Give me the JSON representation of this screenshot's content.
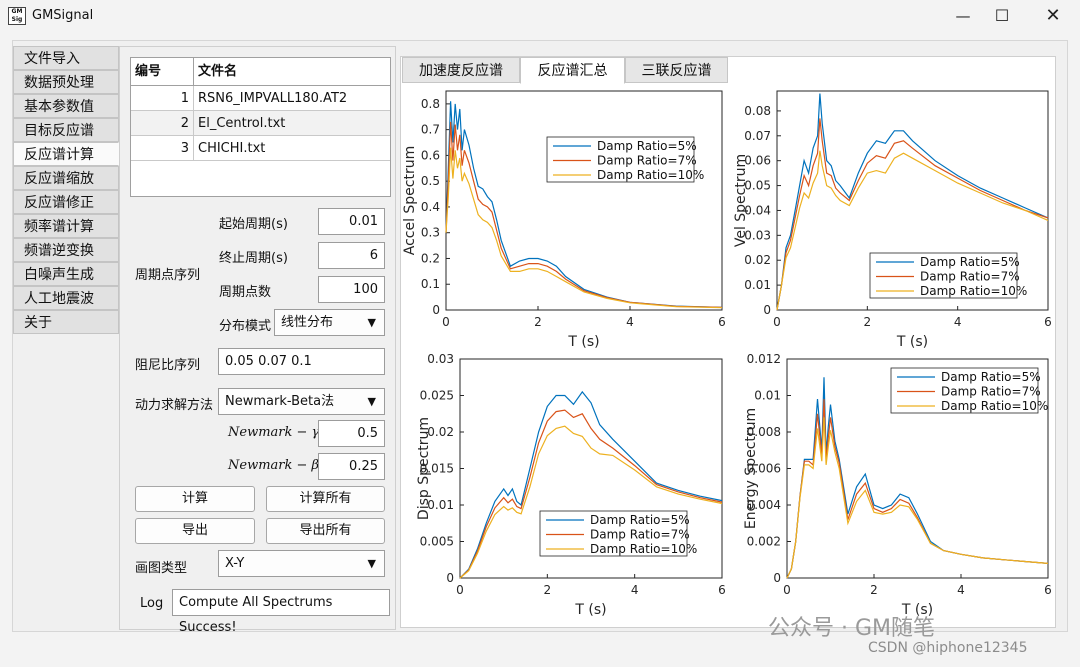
{
  "window": {
    "title": "GMSignal",
    "icon_text": "GM Signal",
    "minimize_icon": "minimize-icon",
    "maximize_icon": "maximize-icon",
    "close_icon": "close-icon"
  },
  "sidebar": {
    "items": [
      {
        "label": "文件导入"
      },
      {
        "label": "数据预处理"
      },
      {
        "label": "基本参数值"
      },
      {
        "label": "目标反应谱"
      },
      {
        "label": "反应谱计算"
      },
      {
        "label": "反应谱缩放"
      },
      {
        "label": "反应谱修正"
      },
      {
        "label": "频率谱计算"
      },
      {
        "label": "频谱逆变换"
      },
      {
        "label": "白噪声生成"
      },
      {
        "label": "人工地震波"
      },
      {
        "label": "关于"
      }
    ],
    "active_index": 4
  },
  "file_table": {
    "headers": [
      "编号",
      "文件名"
    ],
    "rows": [
      {
        "num": "1",
        "name": "RSN6_IMPVALL180.AT2"
      },
      {
        "num": "2",
        "name": "El_Centrol.txt"
      },
      {
        "num": "3",
        "name": "CHICHI.txt"
      }
    ]
  },
  "period": {
    "group_label": "周期点序列",
    "start_label": "起始周期(s)",
    "start_value": "0.01",
    "end_label": "终止周期(s)",
    "end_value": "6",
    "count_label": "周期点数",
    "count_value": "100",
    "dist_label": "分布模式",
    "dist_value": "线性分布"
  },
  "damping": {
    "label": "阻尼比序列",
    "value": "0.05  0.07   0.1"
  },
  "solver": {
    "label": "动力求解方法",
    "value": "Newmark-Beta法"
  },
  "newmark": {
    "gamma_label": "Newmark − γ",
    "gamma_value": "0.5",
    "beta_label": "Newmark − β",
    "beta_value": "0.25"
  },
  "buttons": {
    "compute": "计算",
    "compute_all": "计算所有",
    "export": "导出",
    "export_all": "导出所有"
  },
  "plot_type": {
    "label": "画图类型",
    "value": "X-Y"
  },
  "log": {
    "label": "Log",
    "value": "Compute All Spectrums Success!"
  },
  "tabs": [
    {
      "label": "加速度反应谱"
    },
    {
      "label": "反应谱汇总"
    },
    {
      "label": "三联反应谱"
    }
  ],
  "active_tab": 1,
  "colors": {
    "damp5": "#0072BD",
    "damp7": "#D95319",
    "damp10": "#EDB120"
  },
  "watermark": {
    "text": "公众号 · GM随笔",
    "csdn": "CSDN @hiphone12345"
  },
  "chart_data": [
    {
      "type": "line",
      "xlabel": "T (s)",
      "ylabel": "Accel Spectrum",
      "xlim": [
        0,
        6
      ],
      "ylim": [
        0,
        0.85
      ],
      "xticks": [
        0,
        2,
        4,
        6
      ],
      "yticks": [
        0,
        0.1,
        0.2,
        0.3,
        0.4,
        0.5,
        0.6,
        0.7,
        0.8
      ],
      "legend_position": "top-center",
      "x": [
        0,
        0.05,
        0.1,
        0.15,
        0.2,
        0.25,
        0.3,
        0.35,
        0.4,
        0.5,
        0.6,
        0.7,
        0.8,
        0.9,
        1.0,
        1.1,
        1.2,
        1.4,
        1.6,
        1.8,
        2.0,
        2.2,
        2.4,
        2.6,
        3.0,
        3.5,
        4.0,
        5.0,
        6.0
      ],
      "series": [
        {
          "name": "Damp Ratio=5%",
          "values": [
            0.3,
            0.55,
            0.81,
            0.65,
            0.8,
            0.7,
            0.78,
            0.62,
            0.7,
            0.64,
            0.55,
            0.48,
            0.47,
            0.44,
            0.42,
            0.35,
            0.27,
            0.17,
            0.19,
            0.2,
            0.2,
            0.19,
            0.17,
            0.13,
            0.08,
            0.05,
            0.03,
            0.015,
            0.01
          ]
        },
        {
          "name": "Damp Ratio=7%",
          "values": [
            0.3,
            0.5,
            0.73,
            0.58,
            0.72,
            0.62,
            0.68,
            0.56,
            0.62,
            0.57,
            0.5,
            0.43,
            0.41,
            0.4,
            0.38,
            0.31,
            0.24,
            0.16,
            0.17,
            0.18,
            0.18,
            0.17,
            0.15,
            0.12,
            0.075,
            0.048,
            0.03,
            0.014,
            0.01
          ]
        },
        {
          "name": "Damp Ratio=10%",
          "values": [
            0.3,
            0.44,
            0.63,
            0.51,
            0.62,
            0.55,
            0.59,
            0.5,
            0.53,
            0.49,
            0.43,
            0.37,
            0.35,
            0.34,
            0.32,
            0.27,
            0.21,
            0.15,
            0.15,
            0.16,
            0.16,
            0.15,
            0.13,
            0.11,
            0.07,
            0.045,
            0.028,
            0.013,
            0.009
          ]
        }
      ]
    },
    {
      "type": "line",
      "xlabel": "T (s)",
      "ylabel": "Vel Spectrum",
      "xlim": [
        0,
        6
      ],
      "ylim": [
        0,
        0.088
      ],
      "xticks": [
        0,
        2,
        4,
        6
      ],
      "yticks": [
        0,
        0.01,
        0.02,
        0.03,
        0.04,
        0.05,
        0.06,
        0.07,
        0.08
      ],
      "legend_position": "bottom-right",
      "x": [
        0,
        0.1,
        0.2,
        0.3,
        0.4,
        0.5,
        0.6,
        0.7,
        0.8,
        0.9,
        0.95,
        1.0,
        1.1,
        1.2,
        1.3,
        1.4,
        1.6,
        1.8,
        2.0,
        2.2,
        2.4,
        2.6,
        2.8,
        3.0,
        3.5,
        4.0,
        4.5,
        5.0,
        5.5,
        6.0
      ],
      "series": [
        {
          "name": "Damp Ratio=5%",
          "values": [
            0,
            0.01,
            0.025,
            0.03,
            0.04,
            0.05,
            0.06,
            0.055,
            0.065,
            0.07,
            0.087,
            0.075,
            0.06,
            0.058,
            0.052,
            0.05,
            0.045,
            0.055,
            0.063,
            0.068,
            0.067,
            0.072,
            0.072,
            0.068,
            0.06,
            0.054,
            0.049,
            0.045,
            0.041,
            0.037
          ]
        },
        {
          "name": "Damp Ratio=7%",
          "values": [
            0,
            0.01,
            0.023,
            0.028,
            0.037,
            0.046,
            0.054,
            0.05,
            0.058,
            0.063,
            0.077,
            0.068,
            0.055,
            0.054,
            0.049,
            0.047,
            0.044,
            0.052,
            0.059,
            0.062,
            0.061,
            0.067,
            0.068,
            0.065,
            0.058,
            0.053,
            0.048,
            0.044,
            0.04,
            0.037
          ]
        },
        {
          "name": "Damp Ratio=10%",
          "values": [
            0,
            0.01,
            0.021,
            0.025,
            0.033,
            0.041,
            0.047,
            0.045,
            0.051,
            0.055,
            0.064,
            0.058,
            0.05,
            0.049,
            0.046,
            0.044,
            0.042,
            0.049,
            0.055,
            0.056,
            0.055,
            0.061,
            0.063,
            0.061,
            0.056,
            0.051,
            0.047,
            0.043,
            0.04,
            0.036
          ]
        }
      ]
    },
    {
      "type": "line",
      "xlabel": "T (s)",
      "ylabel": "Disp Spectrum",
      "xlim": [
        0,
        6
      ],
      "ylim": [
        0,
        0.03
      ],
      "xticks": [
        0,
        2,
        4,
        6
      ],
      "yticks": [
        0,
        0.005,
        0.01,
        0.015,
        0.02,
        0.025,
        0.03
      ],
      "legend_position": "bottom-center",
      "x": [
        0,
        0.2,
        0.4,
        0.6,
        0.8,
        1.0,
        1.1,
        1.2,
        1.3,
        1.4,
        1.6,
        1.8,
        2.0,
        2.2,
        2.4,
        2.6,
        2.8,
        3.0,
        3.2,
        3.5,
        4.0,
        4.5,
        5.0,
        5.5,
        6.0
      ],
      "series": [
        {
          "name": "Damp Ratio=5%",
          "values": [
            0,
            0.0012,
            0.004,
            0.0075,
            0.0105,
            0.0122,
            0.0113,
            0.0122,
            0.0105,
            0.01,
            0.015,
            0.02,
            0.0235,
            0.025,
            0.025,
            0.0238,
            0.0255,
            0.024,
            0.021,
            0.019,
            0.016,
            0.013,
            0.012,
            0.0112,
            0.0106
          ]
        },
        {
          "name": "Damp Ratio=7%",
          "values": [
            0,
            0.0011,
            0.0037,
            0.007,
            0.0096,
            0.011,
            0.0103,
            0.0108,
            0.0098,
            0.0095,
            0.0138,
            0.0185,
            0.0215,
            0.0228,
            0.023,
            0.022,
            0.0225,
            0.0205,
            0.019,
            0.0178,
            0.0154,
            0.0128,
            0.0118,
            0.011,
            0.0104
          ]
        },
        {
          "name": "Damp Ratio=10%",
          "values": [
            0,
            0.001,
            0.0034,
            0.0064,
            0.0087,
            0.0098,
            0.0093,
            0.0096,
            0.009,
            0.0088,
            0.0125,
            0.017,
            0.0195,
            0.0205,
            0.0208,
            0.0198,
            0.0194,
            0.0178,
            0.017,
            0.0168,
            0.0148,
            0.0125,
            0.0115,
            0.0108,
            0.0102
          ]
        }
      ]
    },
    {
      "type": "line",
      "xlabel": "T (s)",
      "ylabel": "Energy Spectrum",
      "xlim": [
        0,
        6
      ],
      "ylim": [
        0,
        0.012
      ],
      "xticks": [
        0,
        2,
        4,
        6
      ],
      "yticks": [
        0,
        0.002,
        0.004,
        0.006,
        0.008,
        0.01,
        0.012
      ],
      "legend_position": "top-right",
      "x": [
        0,
        0.1,
        0.2,
        0.3,
        0.4,
        0.5,
        0.6,
        0.7,
        0.8,
        0.85,
        0.9,
        0.95,
        1.0,
        1.1,
        1.2,
        1.4,
        1.6,
        1.8,
        2.0,
        2.2,
        2.4,
        2.6,
        2.8,
        3.0,
        3.3,
        3.6,
        4.0,
        4.5,
        5.0,
        5.5,
        6.0
      ],
      "series": [
        {
          "name": "Damp Ratio=5%",
          "values": [
            0,
            0.0005,
            0.002,
            0.0045,
            0.0065,
            0.0065,
            0.0065,
            0.0098,
            0.007,
            0.011,
            0.0068,
            0.0083,
            0.0095,
            0.0075,
            0.0065,
            0.0035,
            0.005,
            0.0057,
            0.004,
            0.0038,
            0.004,
            0.0046,
            0.0044,
            0.0035,
            0.002,
            0.0015,
            0.0013,
            0.0011,
            0.001,
            0.0009,
            0.0008
          ]
        },
        {
          "name": "Damp Ratio=7%",
          "values": [
            0,
            0.0005,
            0.002,
            0.0045,
            0.0064,
            0.0064,
            0.0062,
            0.009,
            0.0067,
            0.0098,
            0.0065,
            0.0077,
            0.0088,
            0.0072,
            0.0063,
            0.0032,
            0.0046,
            0.0052,
            0.0038,
            0.0036,
            0.0038,
            0.0043,
            0.0041,
            0.0033,
            0.0019,
            0.0015,
            0.0013,
            0.0011,
            0.001,
            0.0009,
            0.0008
          ]
        },
        {
          "name": "Damp Ratio=10%",
          "values": [
            0,
            0.0005,
            0.002,
            0.0044,
            0.0062,
            0.0062,
            0.006,
            0.0082,
            0.0064,
            0.0088,
            0.0062,
            0.0072,
            0.0081,
            0.0069,
            0.006,
            0.003,
            0.0042,
            0.0048,
            0.0036,
            0.0035,
            0.0036,
            0.004,
            0.0039,
            0.0032,
            0.0019,
            0.0015,
            0.0013,
            0.0011,
            0.001,
            0.0009,
            0.0008
          ]
        }
      ]
    }
  ]
}
